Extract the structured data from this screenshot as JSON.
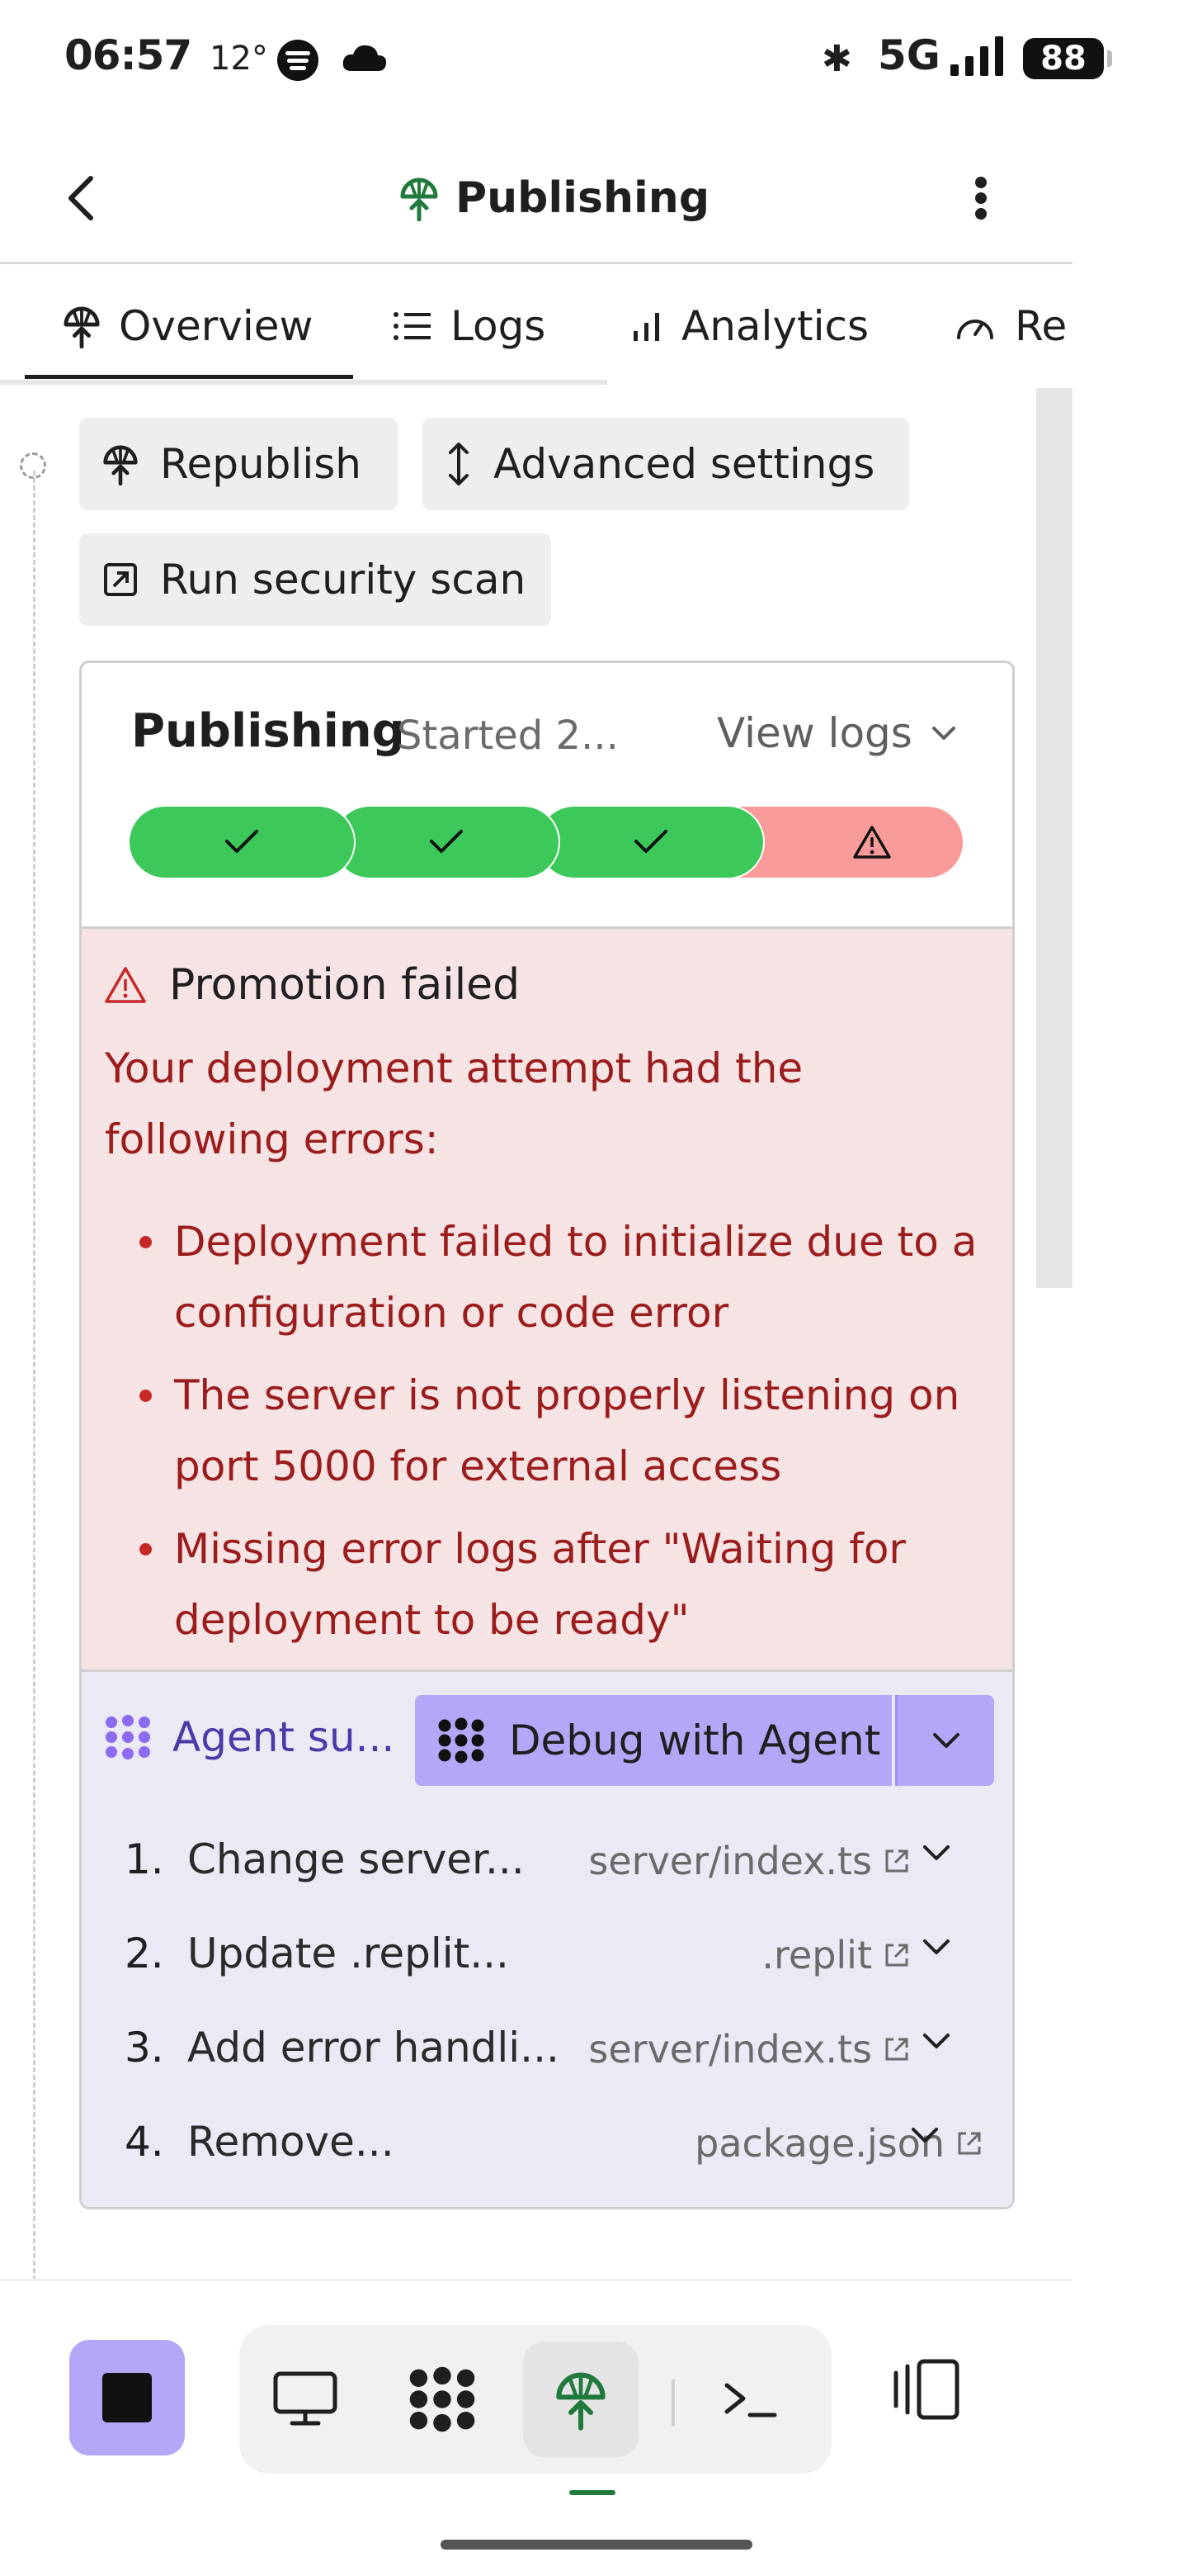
{
  "status_bar": {
    "time": "06:57",
    "temperature": "12°",
    "network": "5G",
    "battery": "88"
  },
  "header": {
    "title": "Publishing"
  },
  "tabs": [
    {
      "label": "Overview",
      "icon": "publish-icon",
      "active": true
    },
    {
      "label": "Logs",
      "icon": "list-icon",
      "active": false
    },
    {
      "label": "Analytics",
      "icon": "bar-chart-icon",
      "active": false
    },
    {
      "label": "Re",
      "icon": "gauge-icon",
      "active": false
    }
  ],
  "actions": {
    "republish": "Republish",
    "advanced_settings": "Advanced settings",
    "security_scan": "Run security scan"
  },
  "publish_card": {
    "title": "Publishing",
    "started": "Started 2...",
    "view_logs": "View logs",
    "steps": [
      {
        "status": "success"
      },
      {
        "status": "success"
      },
      {
        "status": "success"
      },
      {
        "status": "failed"
      }
    ],
    "colors": {
      "success": "#3cc95a",
      "failed": "#f99b99"
    }
  },
  "error": {
    "heading": "Promotion failed",
    "intro": "Your deployment attempt had the following errors:",
    "items": [
      "Deployment failed to initialize due to a configuration or code error",
      "The server is not properly listening on port 5000 for external access",
      "Missing error logs after \"Waiting for deployment to be ready\""
    ]
  },
  "agent": {
    "label": "Agent su...",
    "debug_button": "Debug with Agent",
    "suggestions": [
      {
        "num": "1.",
        "title": "Change server...",
        "file": "server/index.ts"
      },
      {
        "num": "2.",
        "title": "Update .replit...",
        "file": ".replit"
      },
      {
        "num": "3.",
        "title": "Add error handli...",
        "file": "server/index.ts"
      },
      {
        "num": "4.",
        "title": "Remove...",
        "file": "package.json"
      }
    ]
  },
  "bottom_nav": {
    "items": [
      "stop-icon",
      "desktop-icon",
      "agent-icon",
      "publish-icon",
      "terminal-icon",
      "device-toggle-icon"
    ],
    "accent": "#b6a6f8"
  }
}
